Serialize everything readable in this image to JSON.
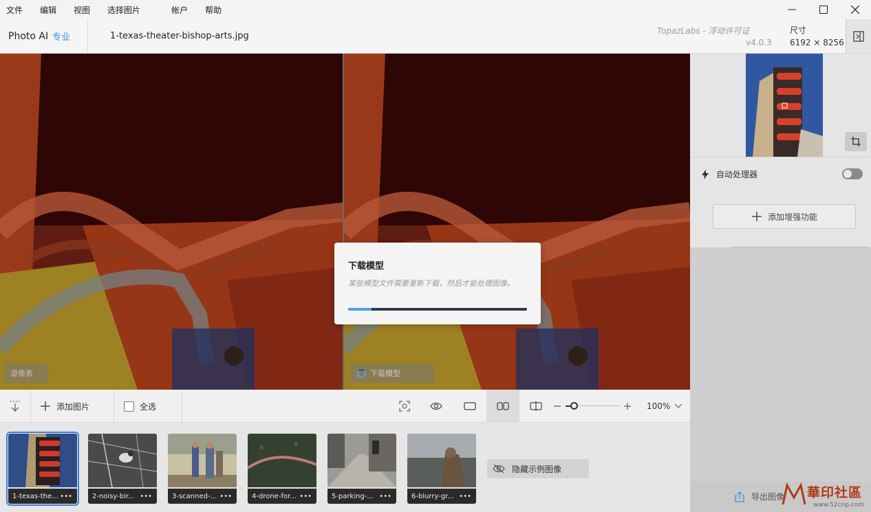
{
  "menu": [
    "文件",
    "编辑",
    "视图",
    "选择图片",
    "帐户",
    "帮助"
  ],
  "header": {
    "app_name": "Photo AI",
    "edition": "专业",
    "filename": "1-texas-theater-bishop-arts.jpg",
    "license": "TopazLabs - 浮动许可证",
    "version": "v4.0.3",
    "dimensions_label": "尺寸",
    "dimensions_value": "6192 × 8256"
  },
  "preview": {
    "left_label": "源像素",
    "right_label": "下载模型"
  },
  "modal": {
    "title": "下载模型",
    "description": "某些模型文件需要重新下载，然后才能处理图像。",
    "progress_fraction": 0.13
  },
  "toolbar": {
    "add_image": "添加图片",
    "select_all": "全选",
    "zoom_value": "100%"
  },
  "filmstrip": {
    "thumbnails": [
      {
        "caption": "1-texas-the...",
        "more": "•••"
      },
      {
        "caption": "2-noisy-bir...",
        "more": "•••"
      },
      {
        "caption": "3-scanned-...",
        "more": "•••"
      },
      {
        "caption": "4-drone-for...",
        "more": "•••"
      },
      {
        "caption": "5-parking-...",
        "more": "•••"
      },
      {
        "caption": "6-blurry-gr...",
        "more": "•••"
      }
    ],
    "hide_examples": "隐藏示例图像"
  },
  "right_panel": {
    "autopilot_label": "自动处理器",
    "add_enhancement": "添加增强功能",
    "export_label": "导出图像"
  },
  "watermark": {
    "text": "華印社區",
    "url": "www.52cnp.com"
  },
  "colors": {
    "accent": "#3c8de3",
    "progress": "#4a9ff0"
  }
}
